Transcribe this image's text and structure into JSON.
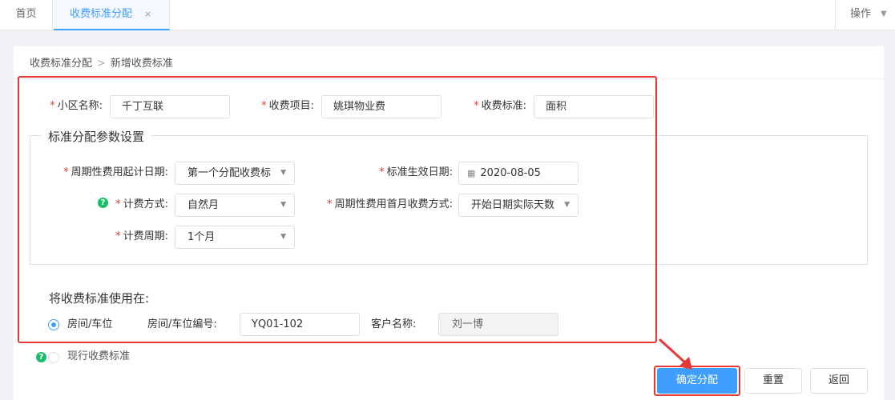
{
  "tabs": {
    "home": "首页",
    "active": "收费标准分配",
    "close": "×",
    "operations": "操作"
  },
  "breadcrumb": {
    "parent": "收费标准分配",
    "separator": ">",
    "current": "新增收费标准"
  },
  "form": {
    "required_mark": "*",
    "community_label": "小区名称:",
    "community_value": "千丁互联",
    "item_label": "收费项目:",
    "item_value": "姚琪物业费",
    "standard_label": "收费标准:",
    "standard_value": "面积"
  },
  "params": {
    "legend": "标准分配参数设置",
    "start_date_label": "周期性费用起计日期:",
    "start_date_value": "第一个分配收费标",
    "effective_date_label": "标准生效日期:",
    "effective_date_value": "2020-08-05",
    "billing_method_label": "计费方式:",
    "billing_method_value": "自然月",
    "first_month_label": "周期性费用首月收费方式:",
    "first_month_value": "开始日期实际天数",
    "billing_cycle_label": "计费周期:",
    "billing_cycle_value": "1个月"
  },
  "apply": {
    "title": "将收费标准使用在:",
    "option_room": "房间/车位",
    "room_no_label": "房间/车位编号:",
    "room_no_value": "YQ01-102",
    "customer_label": "客户名称:",
    "customer_value": "刘一博",
    "option_current": "现行收费标准"
  },
  "buttons": {
    "confirm": "确定分配",
    "reset": "重置",
    "back": "返回"
  },
  "icons": {
    "help": "?",
    "caret": "▼",
    "calendar": "▦",
    "chevron": ">"
  },
  "colors": {
    "accent": "#409eff",
    "highlight": "#e53935",
    "help": "#19be6b"
  }
}
